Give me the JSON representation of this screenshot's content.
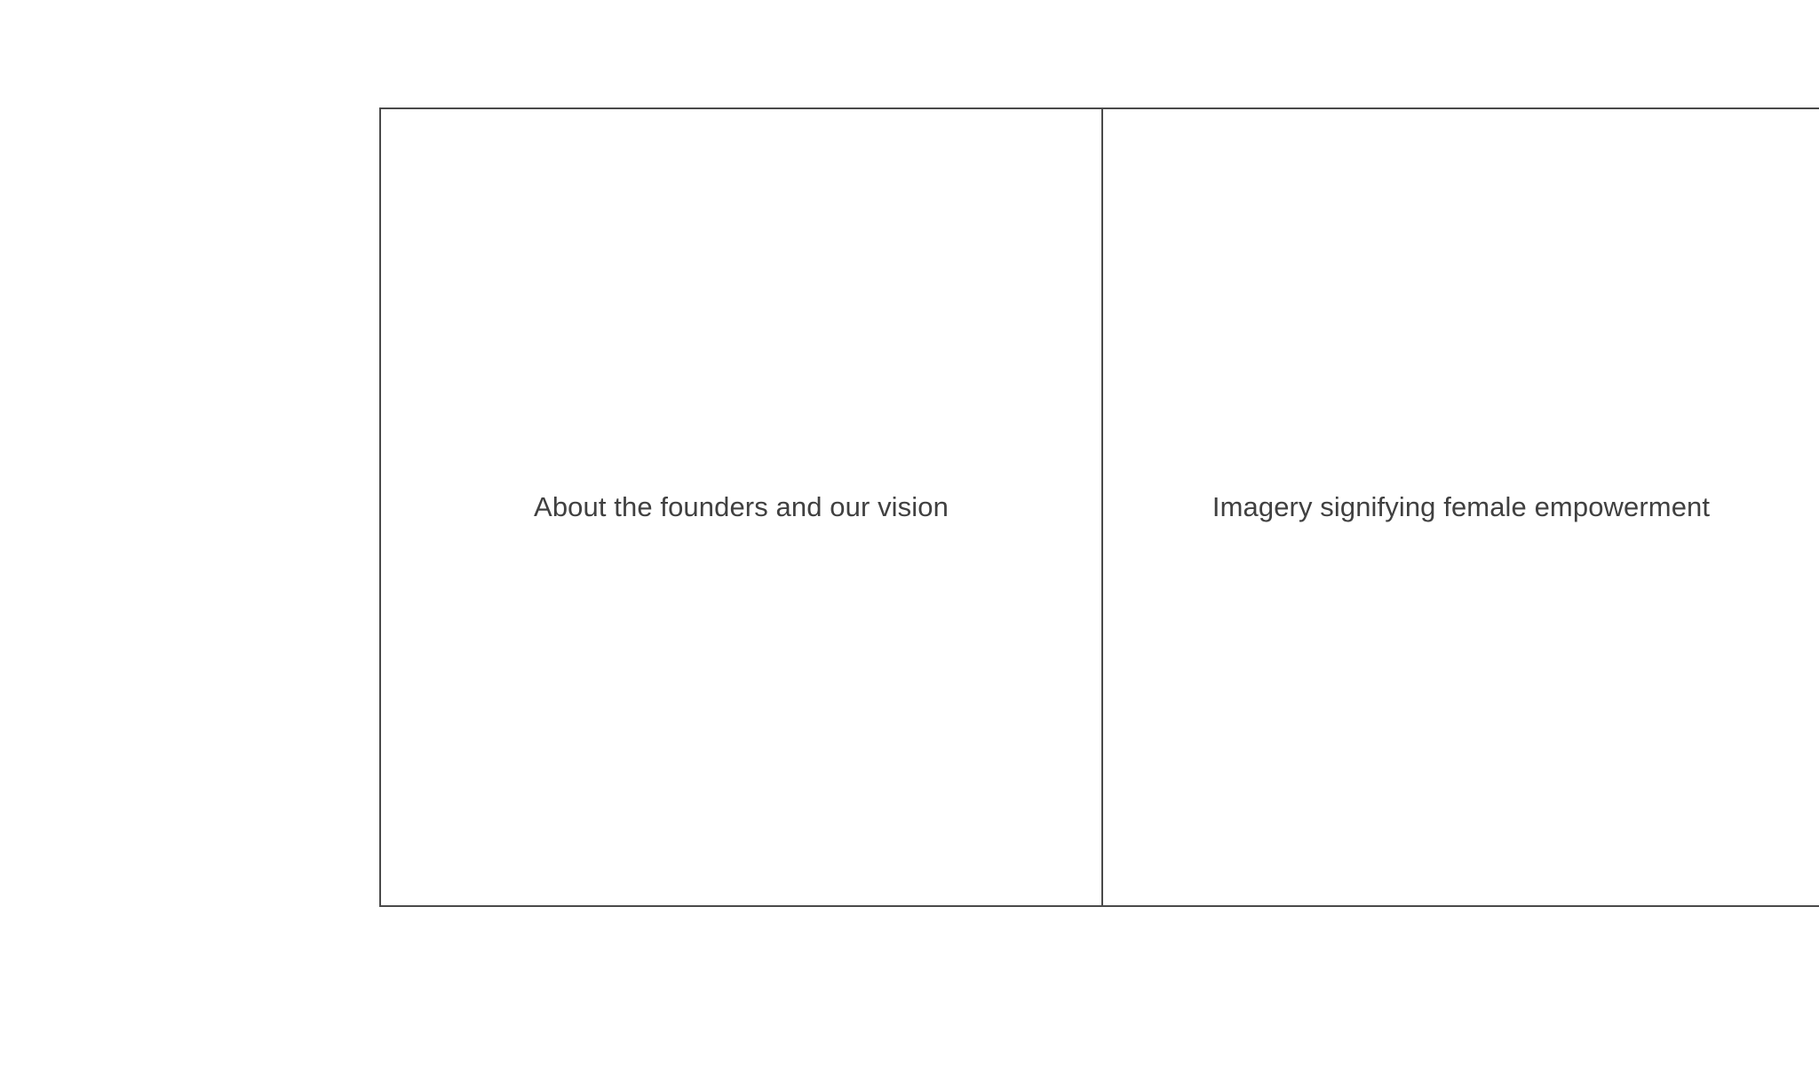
{
  "panels": {
    "left": {
      "label": "About the founders and our vision"
    },
    "right": {
      "label": "Imagery signifying female empowerment"
    }
  }
}
